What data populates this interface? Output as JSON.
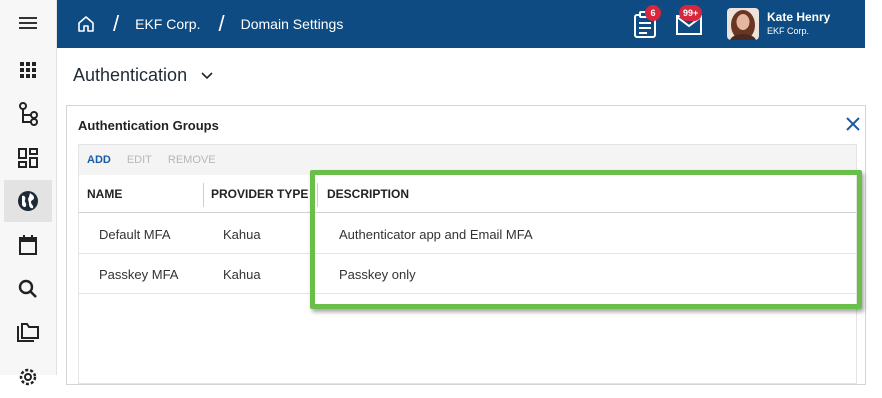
{
  "breadcrumb": {
    "items": [
      "EKF Corp.",
      "Domain Settings"
    ]
  },
  "header": {
    "tasks_badge": "6",
    "messages_badge": "99+",
    "user_name": "Kate Henry",
    "user_org": "EKF Corp.",
    "bg_color": "#0d4b82",
    "badge_color": "#d7263d"
  },
  "page": {
    "title": "Authentication"
  },
  "panel": {
    "title": "Authentication Groups",
    "toolbar": {
      "add": "ADD",
      "edit": "EDIT",
      "remove": "REMOVE"
    },
    "columns": {
      "name": "NAME",
      "provider_type": "PROVIDER TYPE",
      "description": "DESCRIPTION"
    },
    "rows": [
      {
        "name": "Default MFA",
        "provider_type": "Kahua",
        "description": "Authenticator app and Email MFA"
      },
      {
        "name": "Passkey MFA",
        "provider_type": "Kahua",
        "description": "Passkey only"
      }
    ]
  },
  "sidebar": {
    "icons": [
      "menu-icon",
      "apps-grid-icon",
      "hierarchy-icon",
      "dashboard-icon",
      "globe-icon",
      "calendar-icon",
      "search-icon",
      "folders-icon",
      "settings-icon"
    ],
    "active": "globe-icon"
  },
  "annotation": {
    "highlight_color": "#6abf4b"
  }
}
